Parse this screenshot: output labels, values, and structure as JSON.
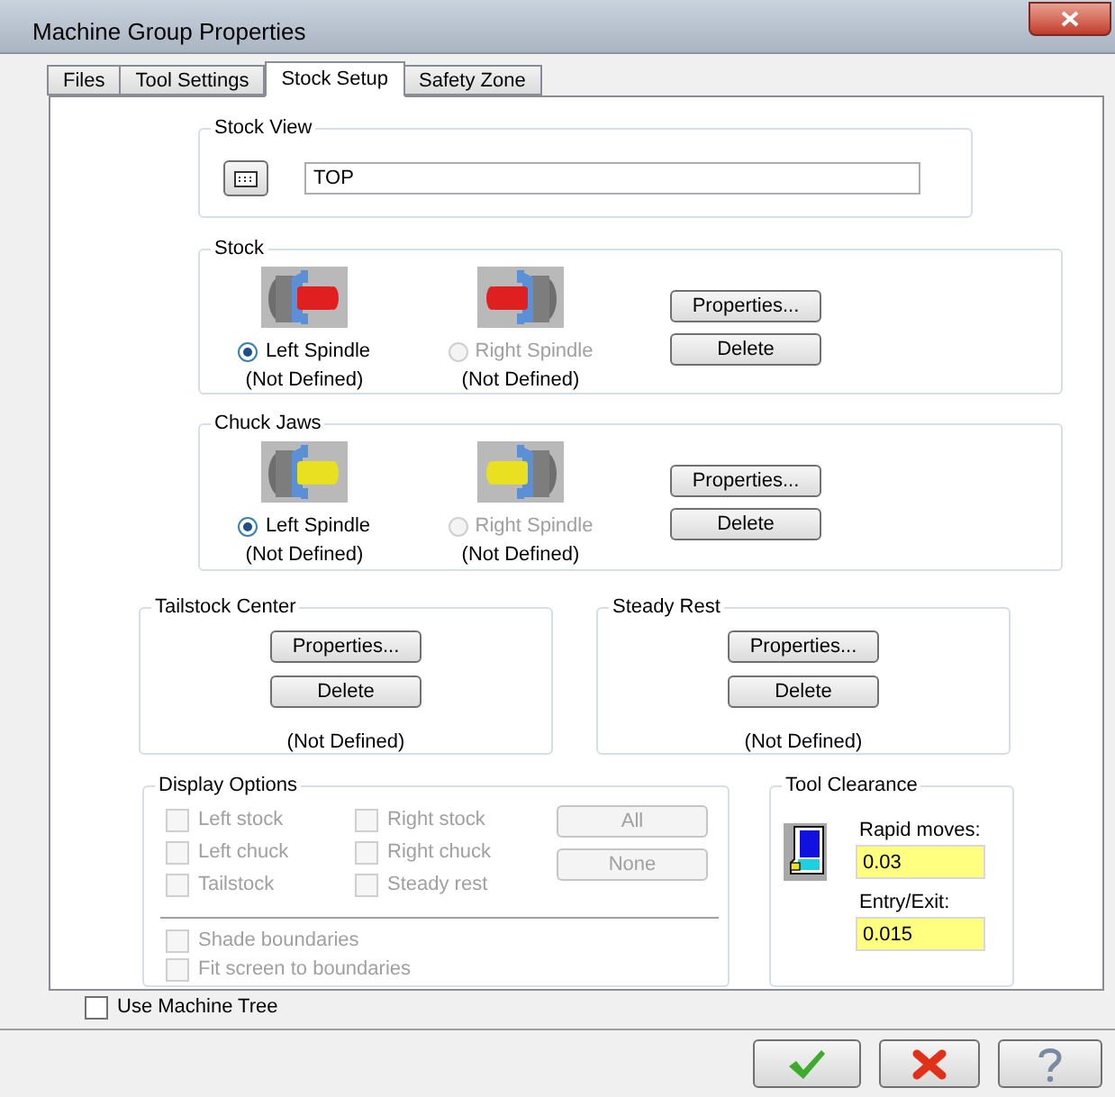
{
  "window": {
    "title": "Machine Group Properties"
  },
  "tabs": [
    {
      "label": "Files",
      "selected": false
    },
    {
      "label": "Tool Settings",
      "selected": false
    },
    {
      "label": "Stock Setup",
      "selected": true
    },
    {
      "label": "Safety Zone",
      "selected": false
    }
  ],
  "stock_view": {
    "title": "Stock View",
    "value": "TOP"
  },
  "spindle_groups": [
    {
      "kind": "stock",
      "title": "Stock",
      "options": [
        {
          "label": "Left Spindle",
          "status": "(Not Defined)",
          "selected": true,
          "disabled": false
        },
        {
          "label": "Right Spindle",
          "status": "(Not Defined)",
          "selected": false,
          "disabled": true
        }
      ],
      "buttons": [
        "Properties...",
        "Delete"
      ]
    },
    {
      "kind": "chuck",
      "title": "Chuck Jaws",
      "options": [
        {
          "label": "Left Spindle",
          "status": "(Not Defined)",
          "selected": true,
          "disabled": false
        },
        {
          "label": "Right Spindle",
          "status": "(Not Defined)",
          "selected": false,
          "disabled": true
        }
      ],
      "buttons": [
        "Properties...",
        "Delete"
      ]
    }
  ],
  "support_groups": [
    {
      "title": "Tailstock Center",
      "buttons": [
        "Properties...",
        "Delete"
      ],
      "status": "(Not Defined)"
    },
    {
      "title": "Steady Rest",
      "buttons": [
        "Properties...",
        "Delete"
      ],
      "status": "(Not Defined)"
    }
  ],
  "display_options": {
    "title": "Display Options",
    "checkboxes": [
      {
        "label": "Left stock",
        "checked": false,
        "disabled": true
      },
      {
        "label": "Right stock",
        "checked": false,
        "disabled": true
      },
      {
        "label": "Left chuck",
        "checked": false,
        "disabled": true
      },
      {
        "label": "Right chuck",
        "checked": false,
        "disabled": true
      },
      {
        "label": "Tailstock",
        "checked": false,
        "disabled": true
      },
      {
        "label": "Steady rest",
        "checked": false,
        "disabled": true
      }
    ],
    "buttons": [
      {
        "label": "All",
        "disabled": true
      },
      {
        "label": "None",
        "disabled": true
      }
    ],
    "boundary_checkboxes": [
      {
        "label": "Shade boundaries",
        "checked": false,
        "disabled": true
      },
      {
        "label": "Fit screen to boundaries",
        "checked": false,
        "disabled": true
      }
    ]
  },
  "tool_clearance": {
    "title": "Tool Clearance",
    "fields": [
      {
        "label": "Rapid moves:",
        "value": "0.03"
      },
      {
        "label": "Entry/Exit:",
        "value": "0.015"
      }
    ]
  },
  "use_machine_tree": {
    "label": "Use Machine Tree",
    "checked": false
  },
  "footer_buttons": [
    {
      "kind": "ok"
    },
    {
      "kind": "cancel"
    },
    {
      "kind": "help"
    }
  ]
}
